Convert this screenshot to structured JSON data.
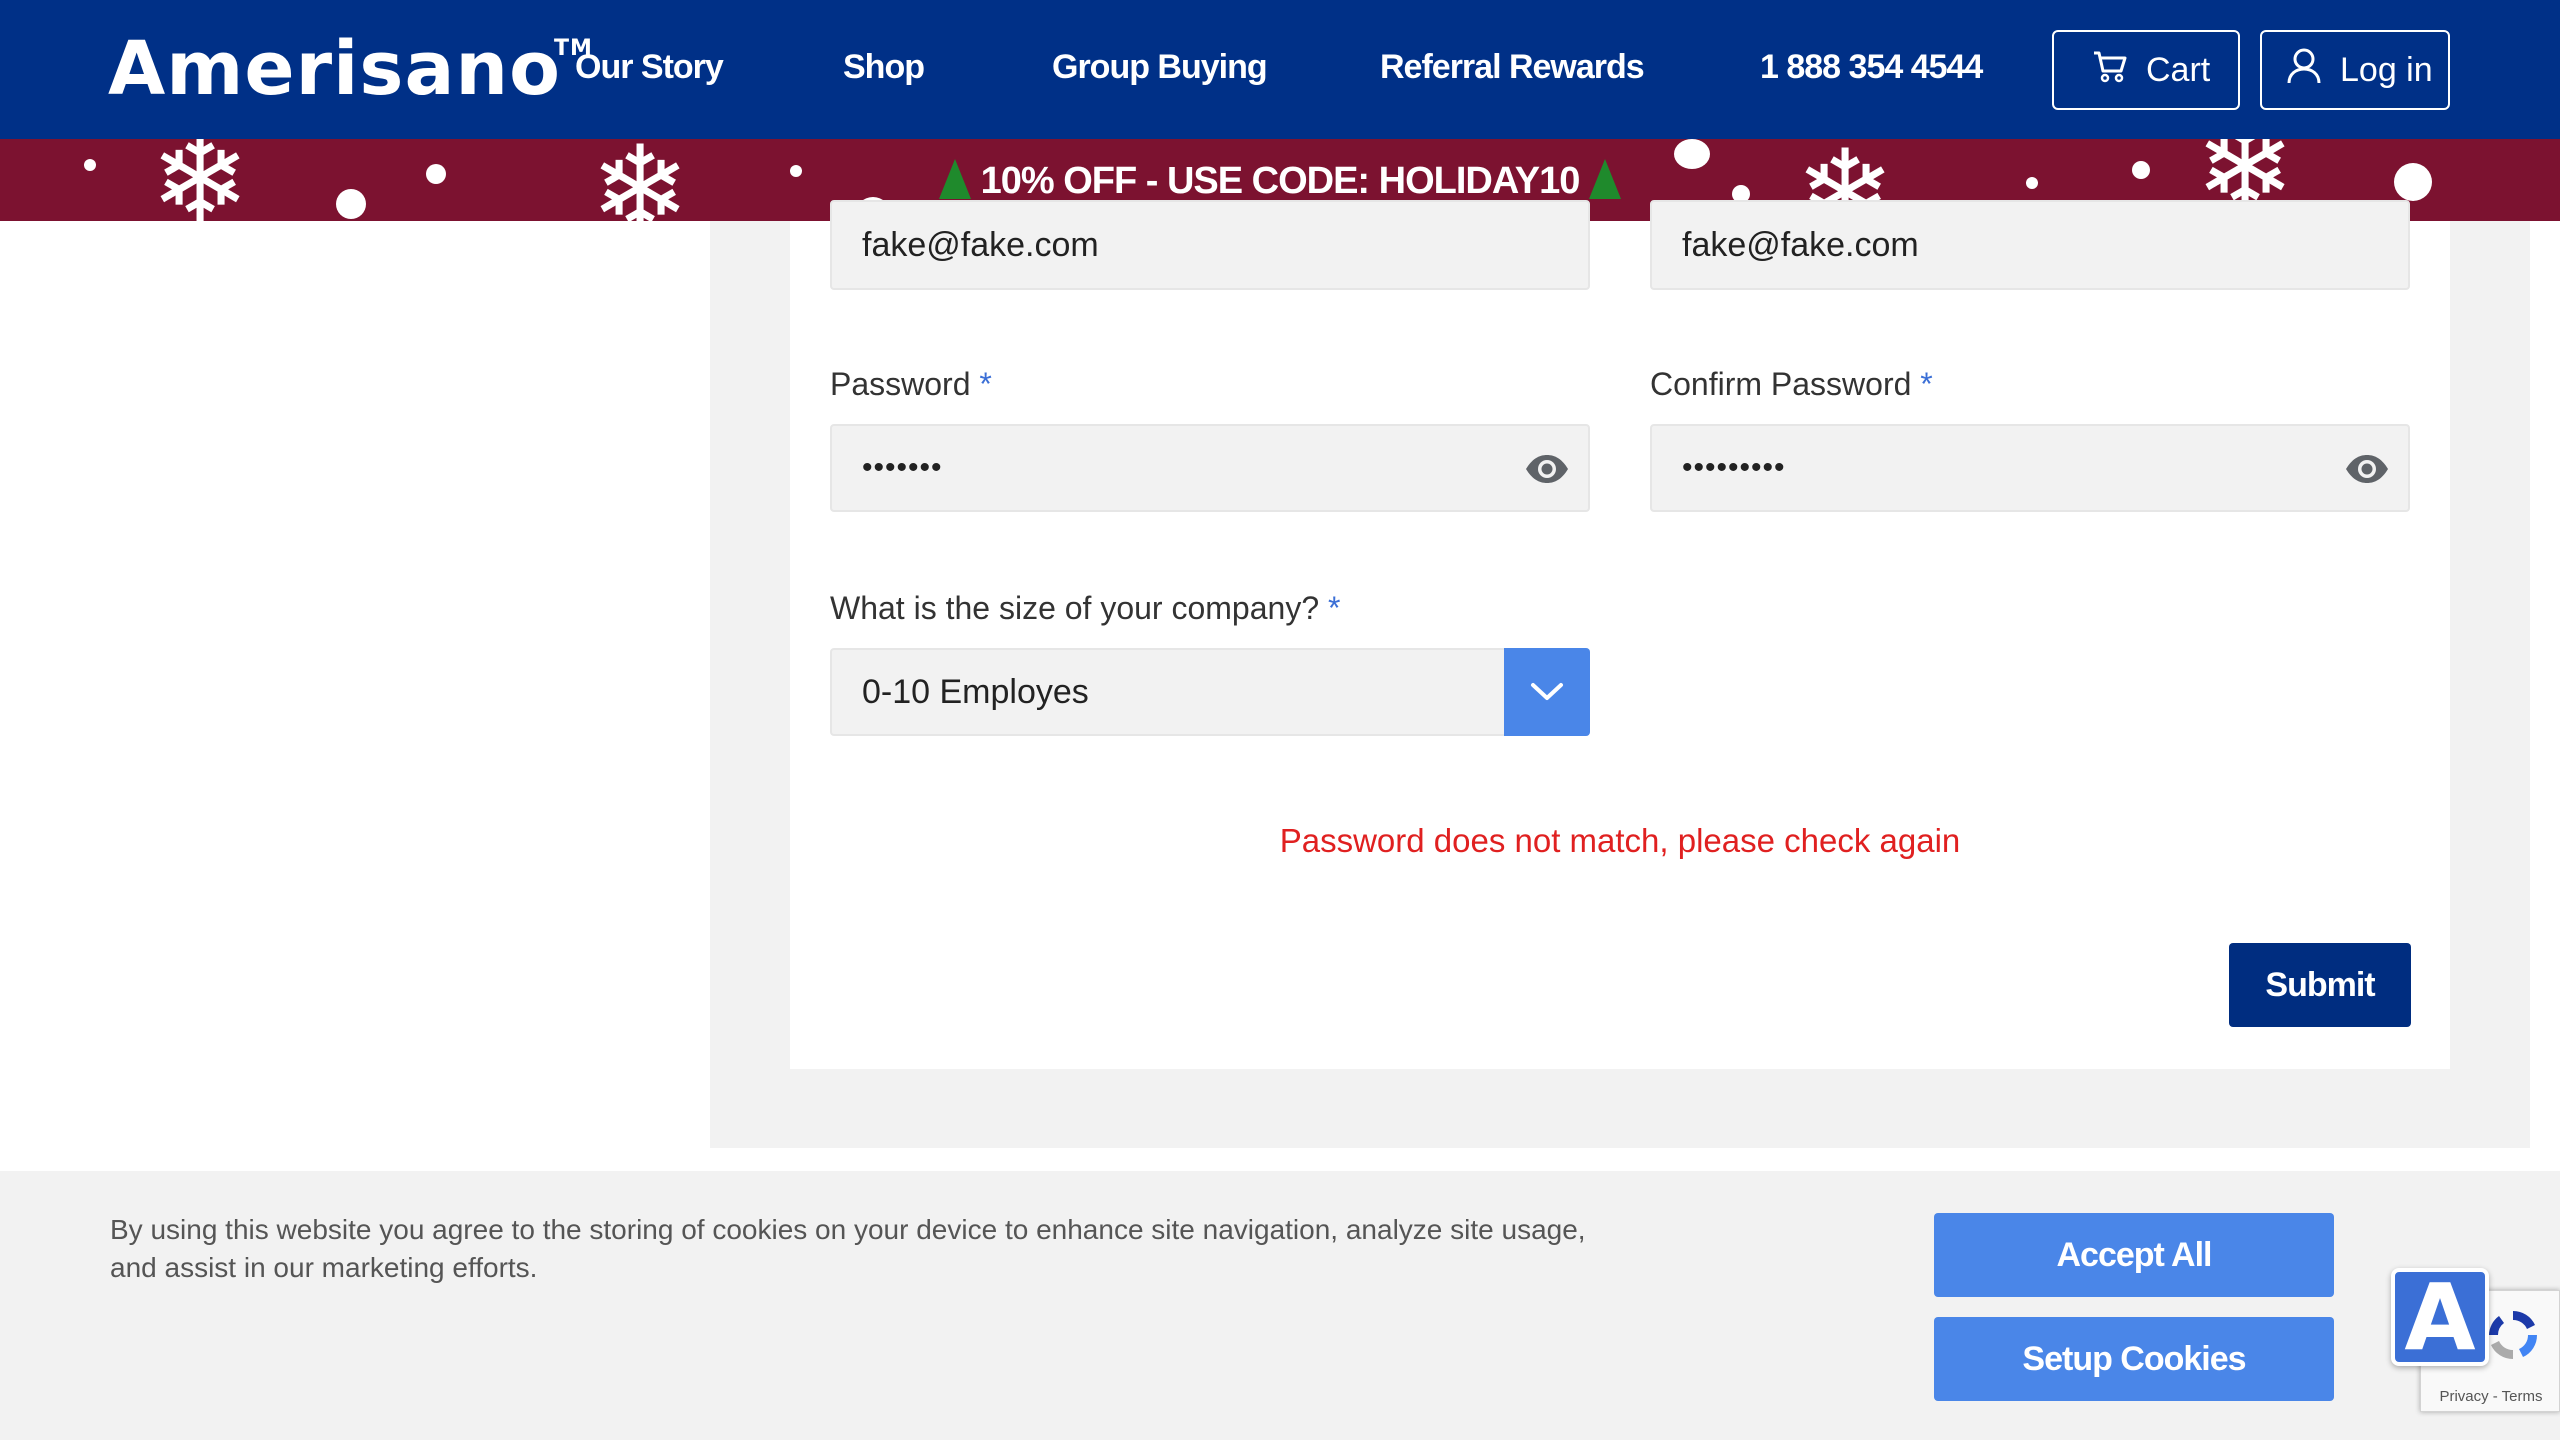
{
  "header": {
    "logo": "Amerisano",
    "logo_tm": "TM",
    "nav": {
      "our_story": "Our Story",
      "shop": "Shop",
      "group_buying": "Group Buying",
      "referral_rewards": "Referral Rewards",
      "phone": "1 888 354 4544"
    },
    "cart_label": "Cart",
    "login_label": "Log in"
  },
  "promo": {
    "text": "10% OFF - USE CODE: HOLIDAY10"
  },
  "form": {
    "email_value": "fake@fake.com",
    "confirm_email_value": "fake@fake.com",
    "password_label": "Password",
    "confirm_password_label": "Confirm Password",
    "required_mark": "*",
    "password_value": "•••••••",
    "confirm_password_value": "•••••••••",
    "company_size_label": "What is the size of your company?",
    "company_size_value": "0-10 Employes",
    "error": "Password does not match, please check again",
    "submit_label": "Submit"
  },
  "cookie": {
    "text": "By using this website you agree to the storing of cookies on your device to enhance site navigation, analyze site usage, and assist in our marketing efforts.",
    "accept_label": "Accept All",
    "setup_label": "Setup Cookies"
  },
  "widgets": {
    "accessibility_letter": "A",
    "recaptcha_terms": "Privacy - Terms"
  },
  "colors": {
    "header_bg": "#003087",
    "promo_bg": "#7c1230",
    "accent": "#4a86e8",
    "error": "#e02020",
    "submit_bg": "#002d80"
  }
}
